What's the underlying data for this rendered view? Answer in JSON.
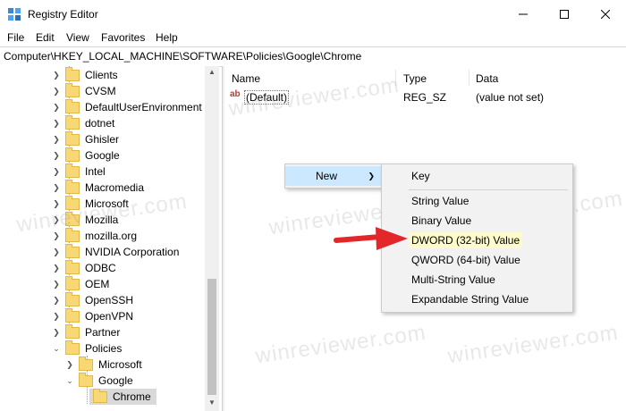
{
  "window": {
    "title": "Registry Editor"
  },
  "menubar": [
    "File",
    "Edit",
    "View",
    "Favorites",
    "Help"
  ],
  "address_bar": {
    "path": "Computer\\HKEY_LOCAL_MACHINE\\SOFTWARE\\Policies\\Google\\Chrome"
  },
  "tree": {
    "items": [
      {
        "label": "Clients"
      },
      {
        "label": "CVSM"
      },
      {
        "label": "DefaultUserEnvironment"
      },
      {
        "label": "dotnet"
      },
      {
        "label": "Ghisler"
      },
      {
        "label": "Google"
      },
      {
        "label": "Intel"
      },
      {
        "label": "Macromedia"
      },
      {
        "label": "Microsoft"
      },
      {
        "label": "Mozilla"
      },
      {
        "label": "mozilla.org"
      },
      {
        "label": "NVIDIA Corporation"
      },
      {
        "label": "ODBC"
      },
      {
        "label": "OEM"
      },
      {
        "label": "OpenSSH"
      },
      {
        "label": "OpenVPN"
      },
      {
        "label": "Partner"
      },
      {
        "label": "Policies"
      },
      {
        "label": "Microsoft"
      },
      {
        "label": "Google"
      },
      {
        "label": "Chrome"
      }
    ],
    "selected_item": "Chrome"
  },
  "list": {
    "columns": [
      "Name",
      "Type",
      "Data"
    ],
    "rows": [
      {
        "name": "(Default)",
        "type": "REG_SZ",
        "data": "(value not set)",
        "icon": "string-value-icon"
      }
    ]
  },
  "context_menu": {
    "item": "New"
  },
  "submenu": {
    "items": [
      "Key",
      "String Value",
      "Binary Value",
      "DWORD (32-bit) Value",
      "QWORD (64-bit) Value",
      "Multi-String Value",
      "Expandable String Value"
    ],
    "highlighted": "DWORD (32-bit) Value"
  },
  "annotation": {
    "arrow_color": "#e3262a"
  },
  "watermark": {
    "text": "winreviewer.com"
  },
  "colors": {
    "menu_hover": "#cce8ff",
    "highlight_yellow": "#fdfbcc",
    "selected_bg": "#d9d9d9",
    "folder": "#f8d775"
  }
}
